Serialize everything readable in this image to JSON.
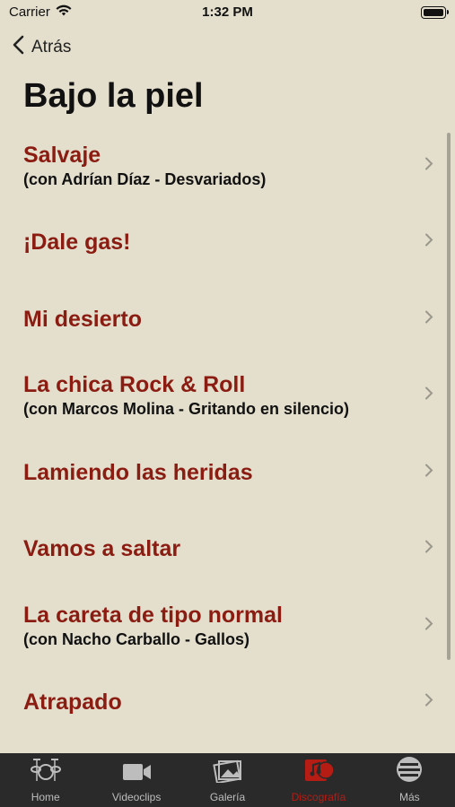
{
  "status_bar": {
    "carrier": "Carrier",
    "time": "1:32 PM"
  },
  "nav": {
    "back_label": "Atrás"
  },
  "page": {
    "title": "Bajo la piel"
  },
  "songs": [
    {
      "title": "Salvaje",
      "collab": "(con Adrían Díaz - Desvariados)"
    },
    {
      "title": "¡Dale gas!",
      "collab": ""
    },
    {
      "title": "Mi desierto",
      "collab": ""
    },
    {
      "title": "La chica Rock & Roll",
      "collab": "(con Marcos Molina - Gritando en silencio)"
    },
    {
      "title": "Lamiendo las heridas",
      "collab": ""
    },
    {
      "title": "Vamos a saltar",
      "collab": ""
    },
    {
      "title": "La careta de tipo normal",
      "collab": "(con Nacho Carballo - Gallos)"
    },
    {
      "title": "Atrapado",
      "collab": ""
    }
  ],
  "tabbar": {
    "tabs": [
      {
        "label": "Home",
        "icon": "drum-kit-icon",
        "active": false
      },
      {
        "label": "Videoclips",
        "icon": "video-camera-icon",
        "active": false
      },
      {
        "label": "Galería",
        "icon": "photo-gallery-icon",
        "active": false
      },
      {
        "label": "Discografía",
        "icon": "music-album-icon",
        "active": true
      },
      {
        "label": "Más",
        "icon": "more-menu-icon",
        "active": false
      }
    ]
  },
  "colors": {
    "background": "#e4dfcd",
    "song_title": "#8a1c12",
    "tabbar_bg": "#2a2a2a",
    "tab_active": "#b41c14",
    "tab_inactive": "#bdbdbd"
  }
}
